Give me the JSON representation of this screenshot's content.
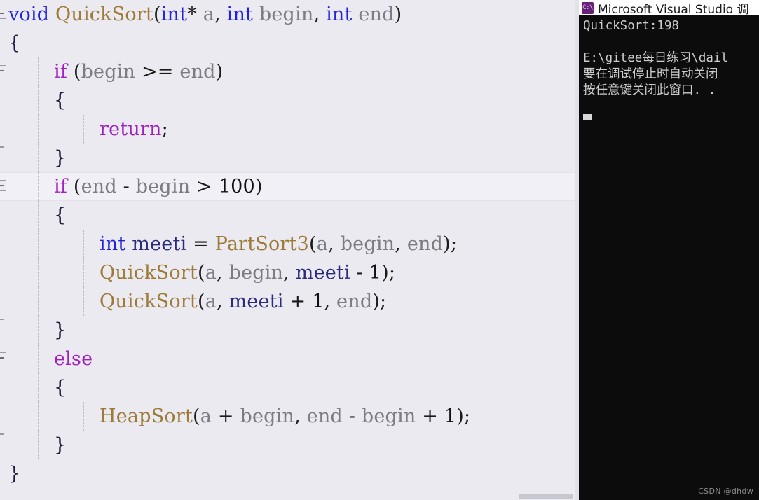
{
  "editor": {
    "background_color": "#ebeaf0",
    "highlight_color": "#f1f0f7",
    "lines": [
      {
        "indent": 0,
        "html_key": "l0",
        "text": "void QuickSort(int* a, int begin, int end)"
      },
      {
        "indent": 0,
        "html_key": "l1",
        "text": "{"
      },
      {
        "indent": 1,
        "html_key": "l2",
        "text": "if (begin >= end)"
      },
      {
        "indent": 1,
        "html_key": "l3",
        "text": "{"
      },
      {
        "indent": 2,
        "html_key": "l4",
        "text": "return;"
      },
      {
        "indent": 1,
        "html_key": "l5",
        "text": "}"
      },
      {
        "indent": 1,
        "html_key": "l6",
        "text": "if (end - begin > 100)"
      },
      {
        "indent": 1,
        "html_key": "l7",
        "text": "{"
      },
      {
        "indent": 2,
        "html_key": "l8",
        "text": "int meeti = PartSort3(a, begin, end);"
      },
      {
        "indent": 2,
        "html_key": "l9",
        "text": "QuickSort(a, begin, meeti - 1);"
      },
      {
        "indent": 2,
        "html_key": "l10",
        "text": "QuickSort(a, meeti + 1, end);"
      },
      {
        "indent": 1,
        "html_key": "l11",
        "text": "}"
      },
      {
        "indent": 1,
        "html_key": "l12",
        "text": "else"
      },
      {
        "indent": 1,
        "html_key": "l13",
        "text": "{"
      },
      {
        "indent": 2,
        "html_key": "l14",
        "text": "HeapSort(a + begin, end - begin + 1);"
      },
      {
        "indent": 1,
        "html_key": "l15",
        "text": "}"
      },
      {
        "indent": 0,
        "html_key": "l16",
        "text": "}"
      }
    ],
    "tokens": {
      "kw_void": "void",
      "fn_quicksort": "QuickSort",
      "kw_int": "int",
      "var_a": "a",
      "var_begin": "begin",
      "var_end": "end",
      "ctrl_if": "if",
      "ctrl_else": "else",
      "ctrl_return": "return",
      "local_meeti": "meeti",
      "fn_partsort3": "PartSort3",
      "fn_heapsort": "HeapSort",
      "num_100": "100",
      "num_1": "1",
      "op_ge": ">=",
      "op_gt": ">",
      "op_minus": "-",
      "op_plus": "+",
      "op_assign": "=",
      "op_star": "*",
      "brace_open": "{",
      "brace_close": "}",
      "semicolon": ";",
      "comma": ",",
      "paren_open": "(",
      "paren_close": ")"
    },
    "colors": {
      "keyword": "#2222dd",
      "control": "#a020c0",
      "function": "#9d7a38",
      "parameter": "#7c7c83",
      "local_variable": "#2b2b7a",
      "punctuation": "#1a1a1a",
      "number": "#111111"
    },
    "highlighted_line_index": 6,
    "fold_marker_lines": [
      0,
      2,
      6,
      12
    ],
    "fold_tick_lines": [
      5,
      11,
      15
    ]
  },
  "console": {
    "title": "Microsoft Visual Studio 调",
    "icon": "console-app-icon",
    "icon_glyph": "C:\\",
    "lines": [
      "QuickSort:198",
      "",
      "E:\\gitee每日练习\\dail",
      "要在调试停止时自动关闭",
      "按任意键关闭此窗口. ."
    ]
  },
  "watermark": {
    "text": "CSDN @dhdw"
  }
}
